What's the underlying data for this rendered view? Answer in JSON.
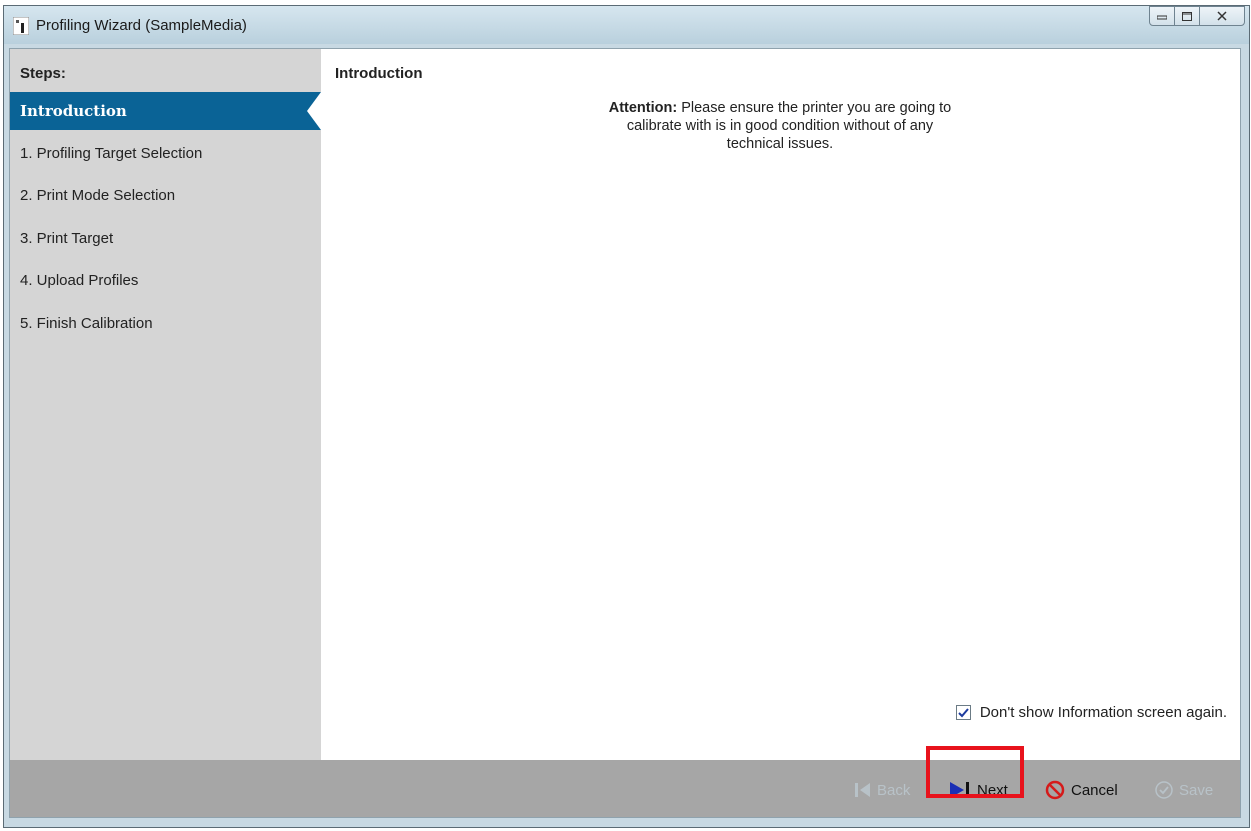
{
  "window": {
    "title": "Profiling Wizard (SampleMedia)"
  },
  "sidebar": {
    "heading": "Steps:",
    "items": [
      {
        "label": "Introduction",
        "active": true
      },
      {
        "label": "1. Profiling Target Selection"
      },
      {
        "label": "2. Print Mode Selection"
      },
      {
        "label": "3. Print Target"
      },
      {
        "label": "4. Upload Profiles"
      },
      {
        "label": "5. Finish Calibration"
      }
    ]
  },
  "main": {
    "title": "Introduction",
    "attention_label": "Attention:",
    "attention_line1": " Please ensure the printer you are going to",
    "attention_line2": "calibrate with is in good condition without of any",
    "attention_line3": "technical issues.",
    "dont_show_label": "Don't show Information screen again.",
    "dont_show_checked": true
  },
  "buttons": {
    "back": "Back",
    "next": "Next",
    "cancel": "Cancel",
    "save": "Save"
  },
  "colors": {
    "accent": "#0a6396",
    "highlight": "#e8121c"
  }
}
